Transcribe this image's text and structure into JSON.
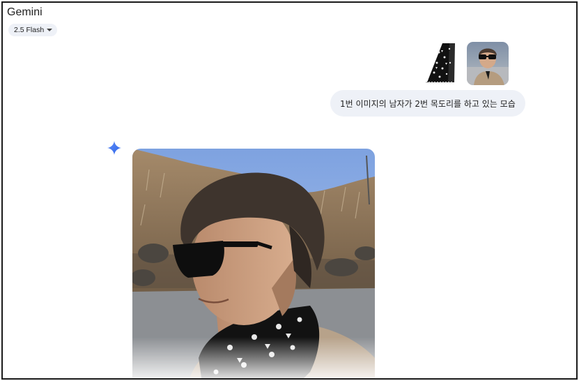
{
  "header": {
    "title": "Gemini",
    "model": "2.5 Flash"
  },
  "conversation": {
    "user_message": {
      "attachments": [
        {
          "icon": "scarf-image-icon"
        },
        {
          "icon": "man-photo-icon"
        }
      ],
      "text": "1번 이미지의 남자가 2번 목도리를 하고 있는 모습"
    },
    "assistant": {
      "icon": "gemini-spark-icon",
      "image_icon": "generated-image-icon"
    }
  },
  "colors": {
    "spark_gradient": [
      "#4f7cf6",
      "#2d64e8"
    ],
    "bubble_bg": "#eef1f7"
  }
}
